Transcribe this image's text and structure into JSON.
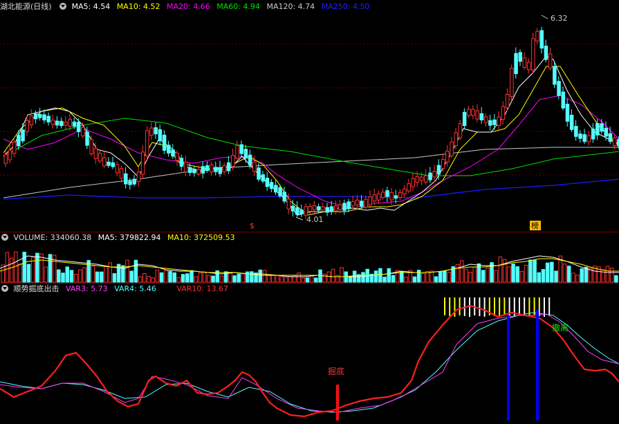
{
  "main_panel": {
    "stock_name": "湖北能源",
    "period": "(日线)",
    "ma5_label": "MA5: 4.54",
    "ma10_label": "MA10: 4.52",
    "ma20_label": "MA20: 4.66",
    "ma60_label": "MA60: 4.94",
    "ma120_label": "MA120: 4.74",
    "ma250_label": "MA250: 4.50",
    "high_marker": "6.32",
    "low_marker": "4.01",
    "mark_s": "$",
    "mark_bang": "榜",
    "colors": {
      "up": "#ff3232",
      "down": "#54ffff",
      "ma5": "#ffffff",
      "ma10": "#ffff00",
      "ma20": "#ff00ff",
      "ma60": "#00e000",
      "ma120": "#cccccc",
      "ma250": "#0000ff"
    }
  },
  "volume_panel": {
    "name": "VOLUME: 334060.38",
    "ma5_label": "MA5: 379822.94",
    "ma10_label": "MA10: 372509.53"
  },
  "indicator_panel": {
    "name": "顺势掘底出击",
    "var3_label": "VAR3: 5.73",
    "var4_label": "VAR4: 5.46",
    "var10_label": "VAR10: 13.67",
    "bottom_signal": "掘底",
    "exit_signal": "撤离"
  }
}
